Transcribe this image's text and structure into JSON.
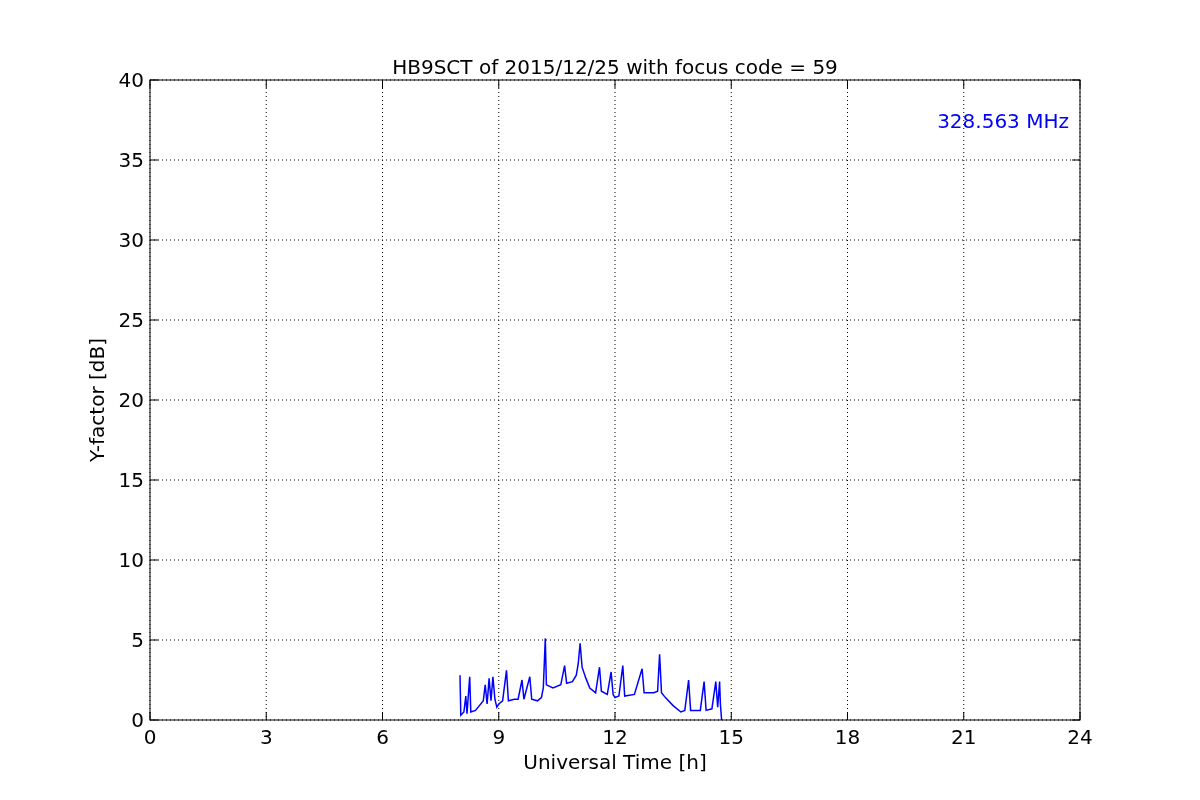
{
  "figure": {
    "chart_data": {
      "type": "line",
      "title": "HB9SCT of 2015/12/25 with focus code = 59",
      "xlabel": "Universal Time [h]",
      "ylabel": "Y-factor [dB]",
      "xlim": [
        0,
        24
      ],
      "ylim": [
        0,
        40
      ],
      "xticks": [
        0,
        3,
        6,
        9,
        12,
        15,
        18,
        21,
        24
      ],
      "yticks": [
        0,
        5,
        10,
        15,
        20,
        25,
        30,
        35,
        40
      ],
      "annotations": [
        {
          "text": "328.563 MHz"
        }
      ],
      "grid": true,
      "x": [
        8.0,
        8.02,
        8.1,
        8.15,
        8.18,
        8.25,
        8.28,
        8.4,
        8.5,
        8.6,
        8.65,
        8.7,
        8.75,
        8.8,
        8.85,
        8.9,
        8.95,
        9.0,
        9.1,
        9.2,
        9.25,
        9.4,
        9.5,
        9.6,
        9.65,
        9.8,
        9.85,
        10.0,
        10.1,
        10.15,
        10.2,
        10.23,
        10.4,
        10.6,
        10.7,
        10.75,
        10.9,
        11.0,
        11.05,
        11.1,
        11.15,
        11.25,
        11.35,
        11.5,
        11.6,
        11.65,
        11.8,
        11.9,
        11.95,
        12.0,
        12.1,
        12.2,
        12.25,
        12.5,
        12.7,
        12.75,
        13.0,
        13.1,
        13.15,
        13.2,
        13.3,
        13.5,
        13.7,
        13.8,
        13.9,
        13.95,
        14.2,
        14.3,
        14.35,
        14.5,
        14.6,
        14.65,
        14.7,
        14.72,
        14.75
      ],
      "series": [
        {
          "color": "#0000ff",
          "values": [
            2.8,
            0.3,
            0.5,
            1.5,
            0.4,
            2.7,
            0.5,
            0.6,
            0.9,
            1.2,
            2.2,
            1.0,
            2.6,
            1.2,
            2.7,
            1.3,
            0.8,
            1.0,
            1.2,
            3.1,
            1.2,
            1.3,
            1.3,
            2.5,
            1.3,
            2.7,
            1.3,
            1.2,
            1.4,
            2.0,
            5.1,
            2.2,
            2.0,
            2.2,
            3.4,
            2.3,
            2.4,
            2.8,
            3.5,
            4.8,
            3.3,
            2.6,
            2.0,
            1.7,
            3.3,
            1.8,
            1.6,
            3.0,
            1.6,
            1.4,
            1.5,
            3.4,
            1.5,
            1.6,
            3.2,
            1.7,
            1.7,
            1.8,
            4.1,
            1.7,
            1.4,
            0.9,
            0.5,
            0.6,
            2.5,
            0.6,
            0.6,
            2.4,
            0.6,
            0.7,
            2.4,
            0.8,
            2.4,
            1.0,
            0.0
          ]
        }
      ]
    }
  }
}
